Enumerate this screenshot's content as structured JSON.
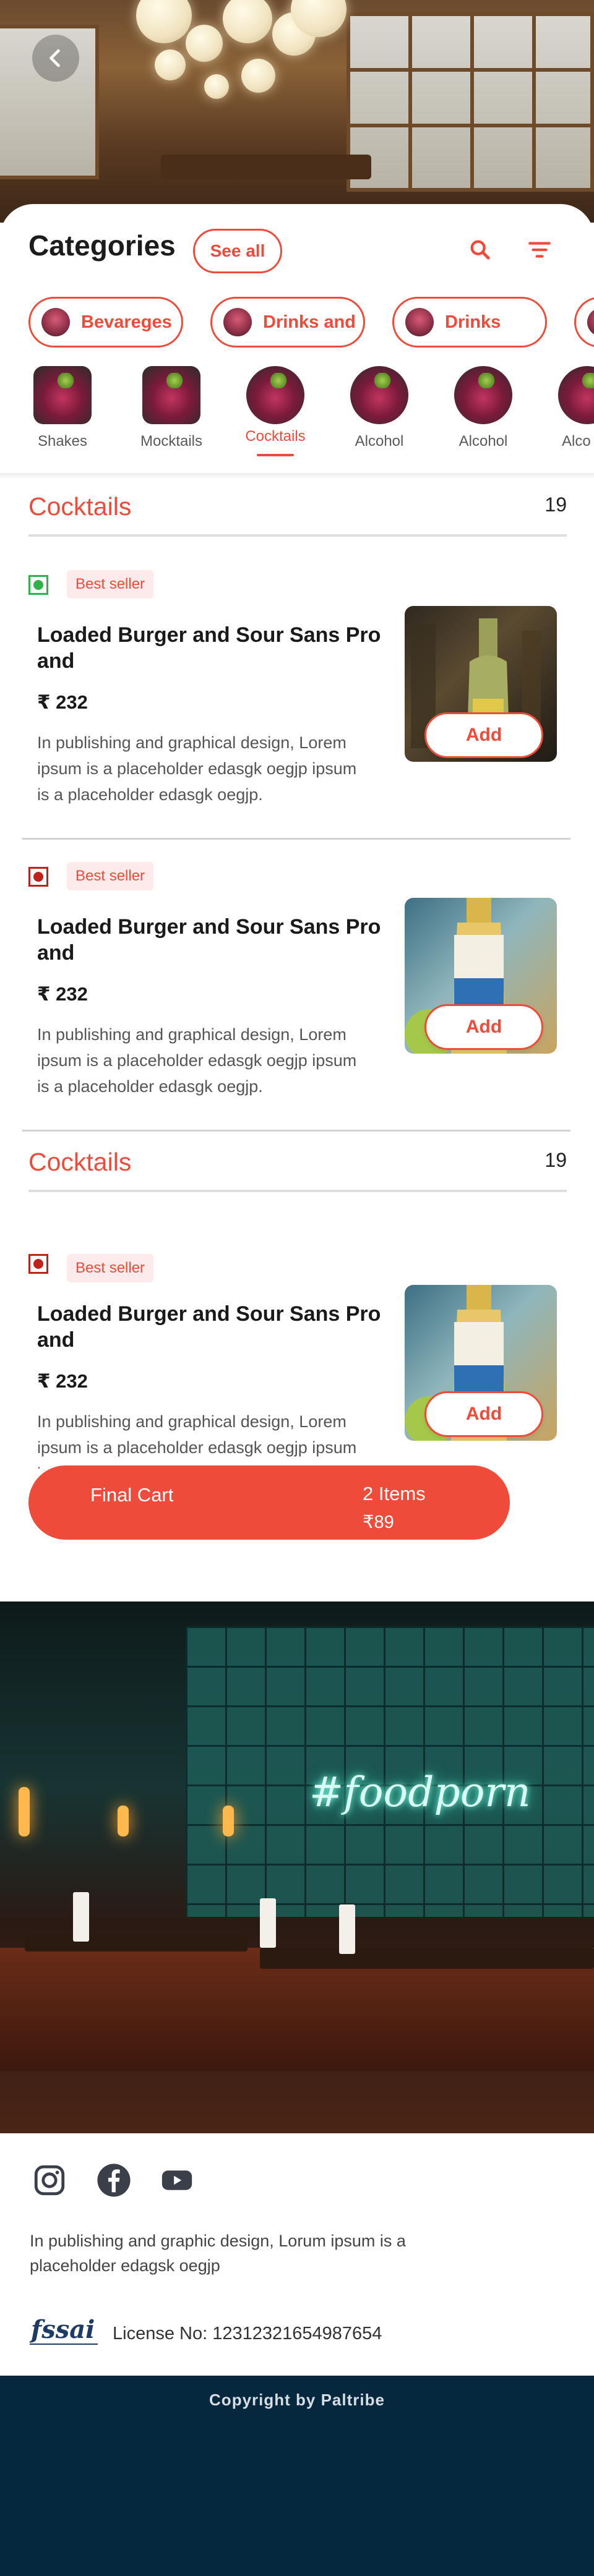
{
  "header": {
    "back_icon": "chevron-left-icon"
  },
  "categories": {
    "title": "Categories",
    "see_all": "See all",
    "search_icon": "search-icon",
    "filter_icon": "filter-icon",
    "accent": "#ef4b3a",
    "chips": [
      {
        "label": "Bevareges"
      },
      {
        "label": "Drinks and"
      },
      {
        "label": "Drinks"
      }
    ],
    "subcategories": [
      {
        "label": "Shakes",
        "active": false
      },
      {
        "label": "Mocktails",
        "active": false
      },
      {
        "label": "Cocktails",
        "active": true
      },
      {
        "label": "Alcohol",
        "active": false
      },
      {
        "label": "Alcohol",
        "active": false
      },
      {
        "label": "Alco",
        "active": false
      }
    ]
  },
  "sections": [
    {
      "name": "Cocktails",
      "count": "19",
      "items": [
        {
          "type": "veg",
          "badge": "Best seller",
          "name": "Loaded Burger and Sour Sans Pro and",
          "price": "₹ 232",
          "description": "In publishing and graphical design, Lorem ipsum is a placeholder edasgk oegjp ipsum is a placeholder edasgk oegjp.",
          "add_label": "Add"
        },
        {
          "type": "non-veg",
          "badge": "Best seller",
          "name": "Loaded Burger and Sour Sans Pro and",
          "price": "₹ 232",
          "description": "In publishing and graphical design, Lorem ipsum is a placeholder edasgk oegjp ipsum is a placeholder edasgk oegjp.",
          "add_label": "Add"
        }
      ]
    },
    {
      "name": "Cocktails",
      "count": "19",
      "items": [
        {
          "type": "non-veg",
          "badge": "Best seller",
          "name": "Loaded Burger and Sour Sans Pro and",
          "price": "₹ 232",
          "description": "In publishing and graphical design, Lorem ipsum is a placeholder edasgk oegjp ipsum is a placeholder edasgk oegjp.",
          "add_label": "Add"
        }
      ]
    }
  ],
  "cart": {
    "label": "Final Cart",
    "items": "2 Items",
    "amount": "₹89"
  },
  "bar_photo": {
    "neon_text": "#foodporn"
  },
  "footer": {
    "social": [
      "instagram-icon",
      "facebook-icon",
      "youtube-icon"
    ],
    "text": "In publishing and graphic design, Lorum ipsum is a placeholder edagsk oegjp",
    "fssai_logo": "fssai",
    "license": "License No: 12312321654987654",
    "copyright": "Copyright by Paltribe"
  },
  "colors": {
    "veg": "#2fb24a",
    "non_veg": "#c0221b",
    "footer_bg": "#06283f"
  }
}
